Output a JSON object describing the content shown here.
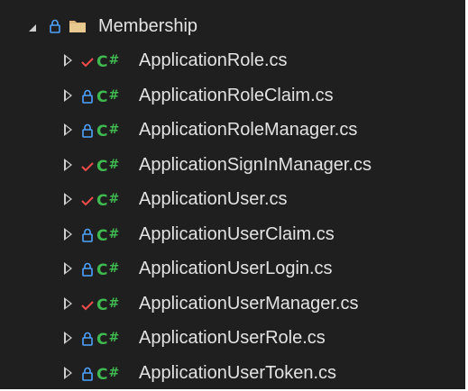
{
  "folder": {
    "name": "Membership",
    "expanded": true,
    "status": "locked"
  },
  "files": [
    {
      "name": "ApplicationRole.cs",
      "status": "checkmark",
      "icon": "csharp-icon"
    },
    {
      "name": "ApplicationRoleClaim.cs",
      "status": "locked",
      "icon": "csharp-icon"
    },
    {
      "name": "ApplicationRoleManager.cs",
      "status": "locked",
      "icon": "csharp-icon"
    },
    {
      "name": "ApplicationSignInManager.cs",
      "status": "checkmark",
      "icon": "csharp-icon"
    },
    {
      "name": "ApplicationUser.cs",
      "status": "checkmark",
      "icon": "csharp-icon"
    },
    {
      "name": "ApplicationUserClaim.cs",
      "status": "locked",
      "icon": "csharp-icon"
    },
    {
      "name": "ApplicationUserLogin.cs",
      "status": "locked",
      "icon": "csharp-icon"
    },
    {
      "name": "ApplicationUserManager.cs",
      "status": "checkmark",
      "icon": "csharp-icon"
    },
    {
      "name": "ApplicationUserRole.cs",
      "status": "locked",
      "icon": "csharp-icon"
    },
    {
      "name": "ApplicationUserToken.cs",
      "status": "locked",
      "icon": "csharp-icon"
    }
  ],
  "colors": {
    "background": "#1f1f1f",
    "text": "#e3e3e3",
    "lock": "#4fa3ff",
    "checkmark": "#f14c4c",
    "csharp": "#3fb950",
    "folder": "#dcb67a"
  }
}
